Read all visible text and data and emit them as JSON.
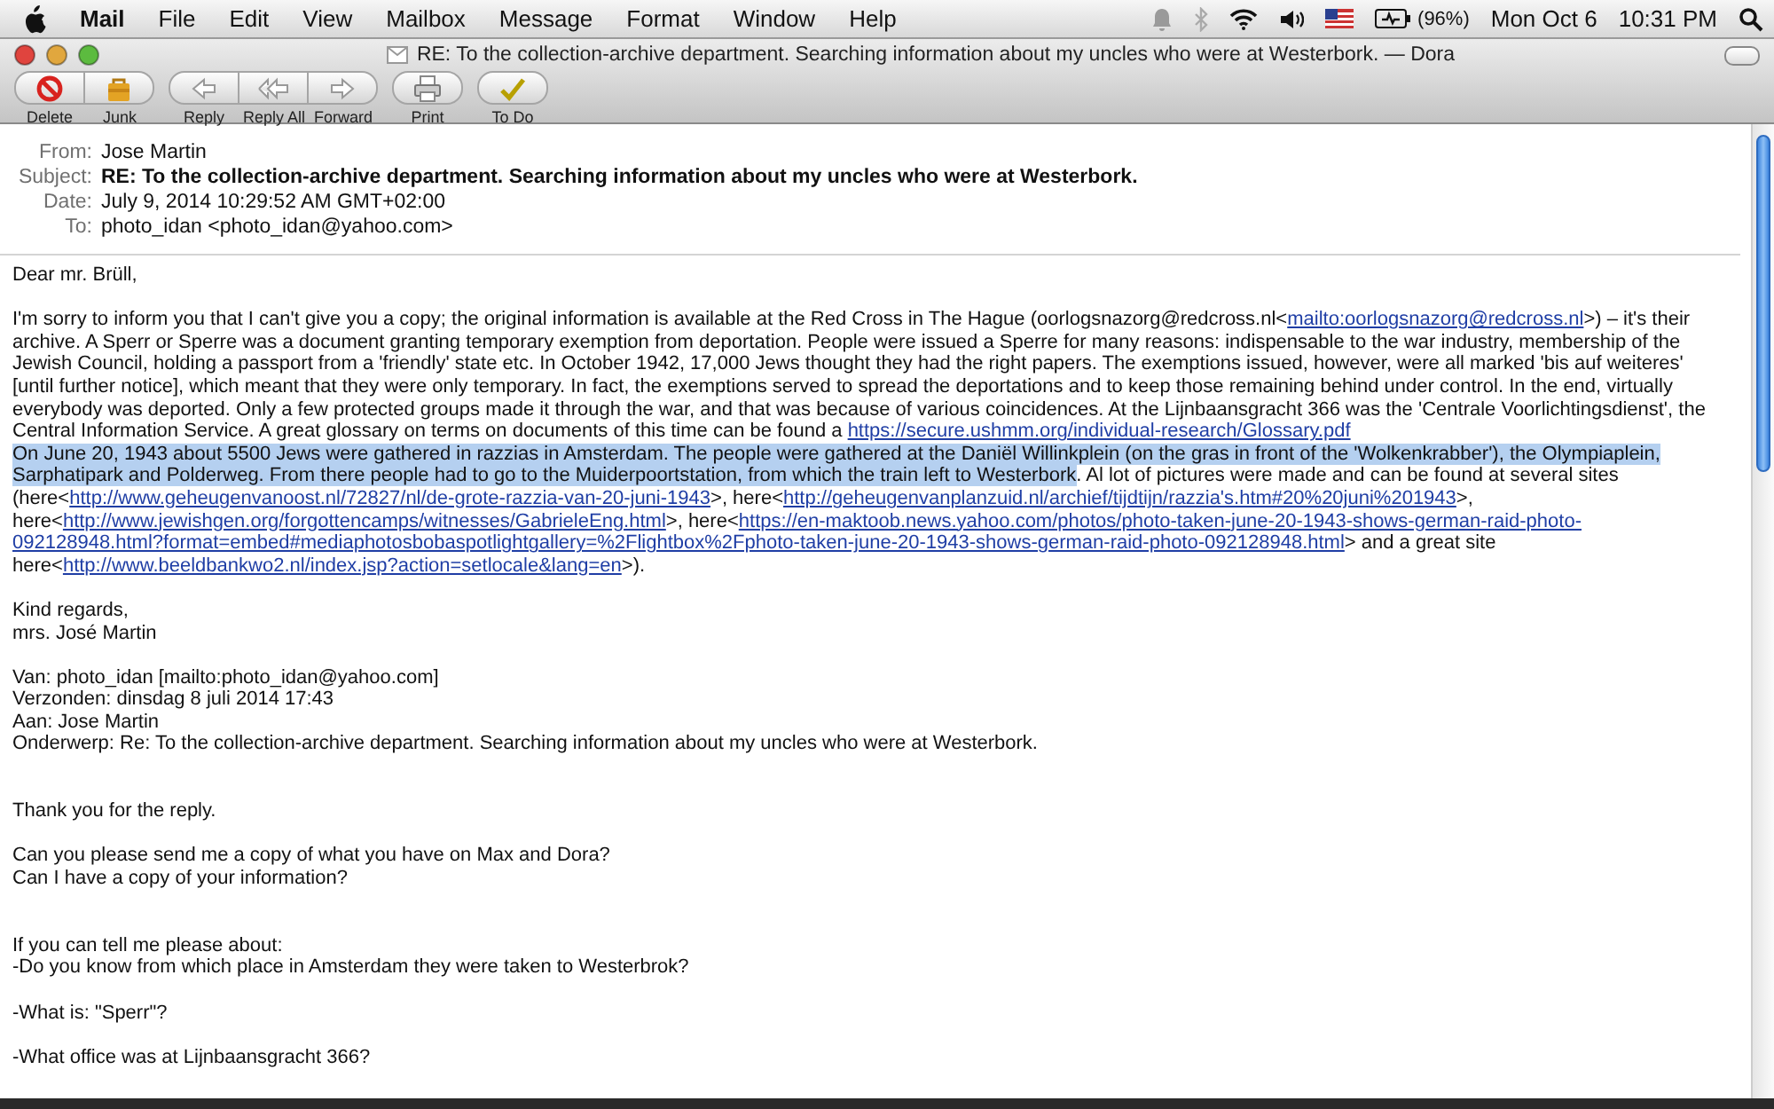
{
  "menu_bar": {
    "app": "Mail",
    "items": [
      "File",
      "Edit",
      "View",
      "Mailbox",
      "Message",
      "Format",
      "Window",
      "Help"
    ],
    "battery": "(96%)",
    "date": "Mon Oct 6",
    "time": "10:31 PM"
  },
  "window": {
    "title": "RE: To the collection-archive department. Searching information about my uncles who were at Westerbork. — Dora"
  },
  "toolbar": {
    "groups": [
      [
        {
          "label": "Delete",
          "kind": "delete"
        },
        {
          "label": "Junk",
          "kind": "junk"
        }
      ],
      [
        {
          "label": "Reply",
          "kind": "reply"
        },
        {
          "label": "Reply All",
          "kind": "reply_all"
        },
        {
          "label": "Forward",
          "kind": "forward"
        }
      ],
      [
        {
          "label": "Print",
          "kind": "print"
        }
      ],
      [
        {
          "label": "To Do",
          "kind": "todo"
        }
      ]
    ]
  },
  "header": {
    "fields": [
      {
        "label": "From:",
        "value": "Jose Martin",
        "bold": false
      },
      {
        "label": "Subject:",
        "value": "RE: To the collection-archive department. Searching information about my uncles who were at Westerbork.",
        "bold": true
      },
      {
        "label": "Date:",
        "value": "July 9, 2014 10:29:52 AM GMT+02:00",
        "bold": false
      },
      {
        "label": "To:",
        "value": "photo_idan <photo_idan@yahoo.com>",
        "bold": false
      }
    ]
  },
  "body": {
    "sections": [
      [
        {
          "kind": "plain",
          "lines": [
            "Dear mr. Brüll,"
          ]
        },
        {
          "kind": "rich",
          "lines": [
            [
              {
                "kind": "text",
                "selected": false,
                "text": "I'm sorry to inform you that I can't give you a copy; the original information is available at the Red Cross in The Hague (oorlogsnazorg@redcross.nl<"
              },
              {
                "kind": "link",
                "selected": false,
                "text": "mailto:oorlogsnazorg@redcross.nl"
              },
              {
                "kind": "text",
                "selected": false,
                "text": ">) – it's their"
              }
            ],
            [
              {
                "kind": "text",
                "selected": false,
                "text": "archive. A Sperr or Sperre was a document granting temporary exemption from deportation. People were issued a Sperre for many reasons: indispensable to the war industry, membership of the"
              }
            ],
            [
              {
                "kind": "text",
                "selected": false,
                "text": "Jewish Council, holding a passport from a 'friendly' state etc. In October 1942, 17,000 Jews thought they had the right papers. The exemptions issued, however, were all marked 'bis auf weiteres'"
              }
            ],
            [
              {
                "kind": "text",
                "selected": false,
                "text": "[until further notice], which meant that they were only temporary. In fact, the exemptions served to spread the deportations and to keep those remaining behind under control. In the end, virtually"
              }
            ],
            [
              {
                "kind": "text",
                "selected": false,
                "text": "everybody was deported. Only a few protected groups made it through the war, and that was because of various coincidences. At the Lijnbaansgracht 366 was the 'Centrale Voorlichtingsdienst', the"
              }
            ],
            [
              {
                "kind": "text",
                "selected": false,
                "text": "Central Information Service. A great glossary on terms on documents of this time can be found a "
              },
              {
                "kind": "link",
                "selected": false,
                "text": "https://secure.ushmm.org/individual-research/Glossary.pdf"
              }
            ],
            [
              {
                "kind": "text",
                "selected": true,
                "text": "On June 20, 1943 about 5500 Jews were gathered in razzias in Amsterdam. The people were gathered at the Daniël Willinkplein (on the gras in front of the 'Wolkenkrabber'), the Olympiaplein,"
              }
            ],
            [
              {
                "kind": "text",
                "selected": true,
                "text": "Sarphatipark and Polderweg. From there people had to go to the Muiderpoortstation, from which the train left to Westerbork"
              },
              {
                "kind": "text",
                "selected": false,
                "text": ". Al lot of pictures were made and can be found at several sites"
              }
            ],
            [
              {
                "kind": "text",
                "selected": false,
                "text": "(here<"
              },
              {
                "kind": "link",
                "selected": false,
                "text": "http://www.geheugenvanoost.nl/72827/nl/de-grote-razzia-van-20-juni-1943"
              },
              {
                "kind": "text",
                "selected": false,
                "text": ">, here<"
              },
              {
                "kind": "link",
                "selected": false,
                "text": "http://geheugenvanplanzuid.nl/archief/tijdtijn/razzia's.htm#20%20juni%201943"
              },
              {
                "kind": "text",
                "selected": false,
                "text": ">,"
              }
            ],
            [
              {
                "kind": "text",
                "selected": false,
                "text": "here<"
              },
              {
                "kind": "link",
                "selected": false,
                "text": "http://www.jewishgen.org/forgottencamps/witnesses/GabrieleEng.html"
              },
              {
                "kind": "text",
                "selected": false,
                "text": ">, here<"
              },
              {
                "kind": "link",
                "selected": false,
                "text": "https://en-maktoob.news.yahoo.com/photos/photo-taken-june-20-1943-shows-german-raid-photo-"
              }
            ],
            [
              {
                "kind": "link",
                "selected": false,
                "text": "092128948.html?format=embed#mediaphotosbobaspotlightgallery=%2Flightbox%2Fphoto-taken-june-20-1943-shows-german-raid-photo-092128948.html"
              },
              {
                "kind": "text",
                "selected": false,
                "text": "> and a great site"
              }
            ],
            [
              {
                "kind": "text",
                "selected": false,
                "text": "here<"
              },
              {
                "kind": "link",
                "selected": false,
                "text": "http://www.beeldbankwo2.nl/index.jsp?action=setlocale&lang=en"
              },
              {
                "kind": "text",
                "selected": false,
                "text": ">)."
              }
            ]
          ]
        },
        {
          "kind": "plain",
          "lines": [
            "Kind regards,",
            "mrs. José Martin"
          ]
        },
        {
          "kind": "plain",
          "lines": [
            "Van: photo_idan [mailto:photo_idan@yahoo.com]",
            "Verzonden: dinsdag 8 juli 2014 17:43",
            "Aan: Jose Martin",
            "Onderwerp: Re: To the collection-archive department. Searching information about my uncles who were at Westerbork."
          ]
        }
      ],
      [
        {
          "kind": "plain",
          "lines": [
            "Thank you for the reply."
          ]
        },
        {
          "kind": "plain",
          "lines": [
            "Can you please send me a copy of what you have on Max and Dora?",
            "Can I have a copy of your information?"
          ]
        }
      ],
      [
        {
          "kind": "plain",
          "lines": [
            "If you can tell me please about:",
            "-Do you know from which place in Amsterdam they were taken to Westerbrok?"
          ]
        },
        {
          "kind": "plain",
          "lines": [
            "-What is: \"Sperr\"?"
          ]
        },
        {
          "kind": "plain",
          "lines": [
            "-What office was at Lijnbaansgracht 366?"
          ]
        }
      ]
    ]
  }
}
